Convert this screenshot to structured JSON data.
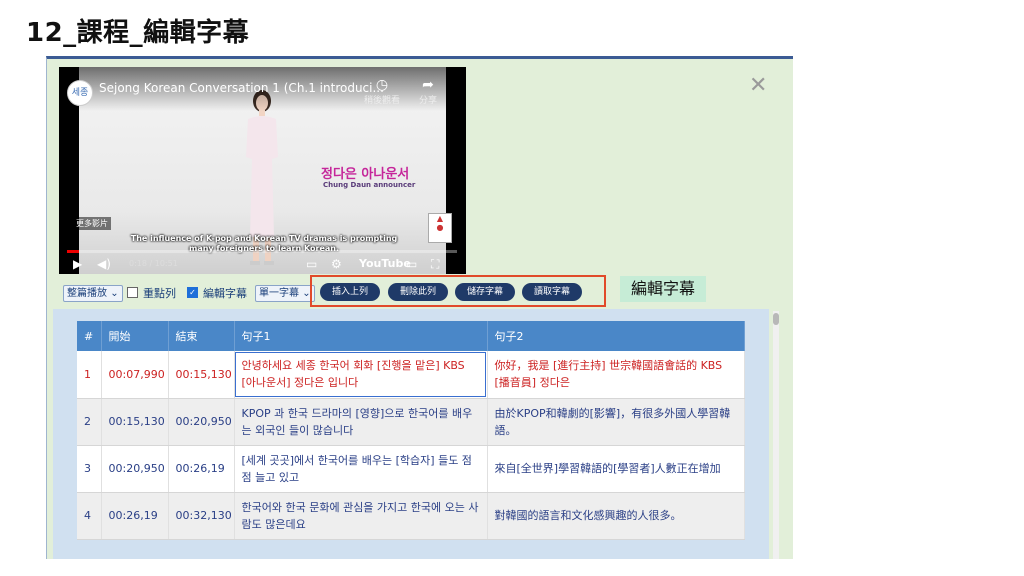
{
  "slide": {
    "title": "12_課程_編輯字幕"
  },
  "video": {
    "title": "Sejong Korean Conversation 1 (Ch.1 introduci...",
    "channel_logo": "세종",
    "watch_later": "稍後觀看",
    "share": "分享",
    "anchor_name": "정다은 아나운서",
    "anchor_sub": "Chung Daun  announcer",
    "more_videos": "更多影片",
    "subtitle_line1": "The influence of K-pop and Korean TV dramas is prompting",
    "subtitle_line2": "many foreigners to learn Korean.",
    "time": "0:18 / 10:51",
    "progress": 0.03,
    "youtube": "YouTube"
  },
  "toolbar": {
    "play_mode": "整篇播放",
    "repeat_label": "重點列",
    "repeat_checked": false,
    "edit_label": "編輯字幕",
    "edit_checked": true,
    "sub_mode": "單一字幕"
  },
  "actions": {
    "insert": "插入上列",
    "delete": "刪除此列",
    "save": "儲存字幕",
    "read": "讀取字幕"
  },
  "callout": "編輯字幕",
  "table": {
    "headers": [
      "#",
      "開始",
      "結束",
      "句子1",
      "句子2"
    ],
    "rows": [
      {
        "n": "1",
        "start": "00:07,990",
        "end": "00:15,130",
        "s1": "안녕하세요 세종 한국어 회화 [진행을 맡은] KBS [아나운서] 정다은 입니다",
        "s2": "你好，我是 [進行主持] 世宗韓國語會話的 KBS [播音員] 정다은"
      },
      {
        "n": "2",
        "start": "00:15,130",
        "end": "00:20,950",
        "s1": "KPOP 과 한국 드라마의 [영향]으로 한국어를 배우는 외국인 들이 많습니다",
        "s2": "由於KPOP和韓劇的[影響]，有很多外國人學習韓語。"
      },
      {
        "n": "3",
        "start": "00:20,950",
        "end": "00:26,19",
        "s1": "[세계 곳곳]에서 한국어를 배우는 [학습자] 들도 점점 늘고 있고",
        "s2": "來自[全世界]學習韓語的[學習者]人數正在增加"
      },
      {
        "n": "4",
        "start": "00:26,19",
        "end": "00:32,130",
        "s1": "한국어와 한국 문화에 관심을 가지고 한국에 오는 사람도 많은데요",
        "s2": "對韓國的語言和文化感興趣的人很多。"
      }
    ]
  }
}
